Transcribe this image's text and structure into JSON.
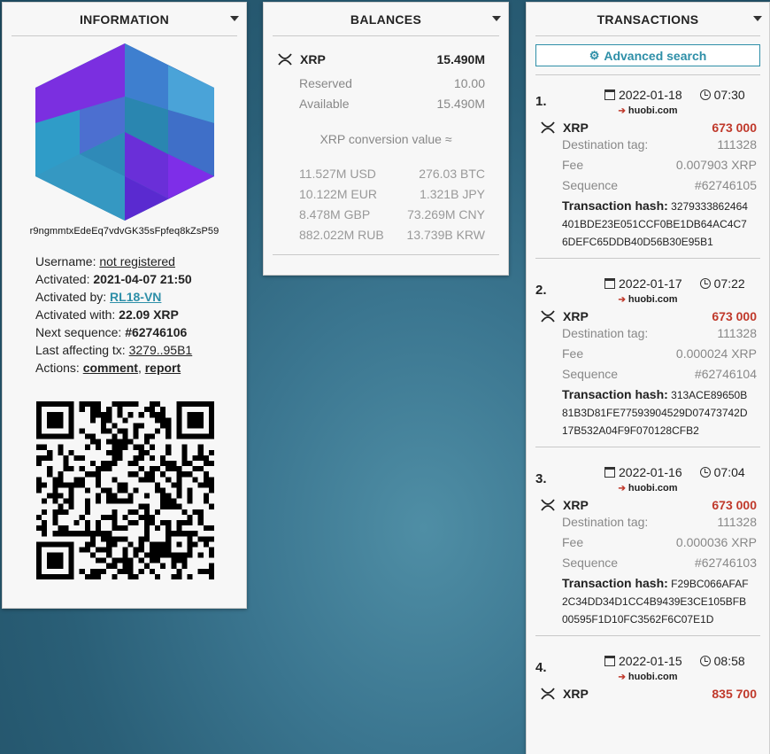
{
  "information": {
    "title": "INFORMATION",
    "address": "r9ngmmtxEdeEq7vdvGK35sFpfeq8kZsP59",
    "username_label": "Username:",
    "username_value": "not registered",
    "activated_label": "Activated:",
    "activated_value": "2021-04-07 21:50",
    "activated_by_label": "Activated by:",
    "activated_by_value": "RL18-VN",
    "activated_with_label": "Activated with:",
    "activated_with_value": "22.09 XRP",
    "next_sequence_label": "Next sequence:",
    "next_sequence_value": "#62746106",
    "last_tx_label": "Last affecting tx:",
    "last_tx_value": "3279..95B1",
    "actions_label": "Actions:",
    "action_comment": "comment",
    "action_sep": ",",
    "action_report": "report"
  },
  "balances": {
    "title": "BALANCES",
    "currency": "XRP",
    "total": "15.490M",
    "reserved_label": "Reserved",
    "reserved_value": "10.00",
    "available_label": "Available",
    "available_value": "15.490M",
    "conversion_title": "XRP conversion value ≈",
    "conversions": [
      [
        "11.527M USD",
        "276.03 BTC"
      ],
      [
        "10.122M EUR",
        "1.321B JPY"
      ],
      [
        "8.478M GBP",
        "73.269M CNY"
      ],
      [
        "882.022M RUB",
        "13.739B KRW"
      ]
    ]
  },
  "transactions": {
    "title": "TRANSACTIONS",
    "advanced_search": "Advanced search",
    "dest_tag_label": "Destination tag:",
    "fee_label": "Fee",
    "sequence_label": "Sequence",
    "hash_label": "Transaction hash:",
    "items": [
      {
        "num": "1.",
        "date": "2022-01-18",
        "time": "07:30",
        "dest": "huobi.com",
        "currency": "XRP",
        "amount": "673 000",
        "dest_tag": "111328",
        "fee": "0.007903 XRP",
        "sequence": "#62746105",
        "hash1": "3279333862464",
        "hash2": "401BDE23E051CCF0BE1DB64AC4C7",
        "hash3": "6DEFC65DDB40D56B30E95B1"
      },
      {
        "num": "2.",
        "date": "2022-01-17",
        "time": "07:22",
        "dest": "huobi.com",
        "currency": "XRP",
        "amount": "673 000",
        "dest_tag": "111328",
        "fee": "0.000024 XRP",
        "sequence": "#62746104",
        "hash1": "313ACE89650B",
        "hash2": "81B3D81FE77593904529D07473742D",
        "hash3": "17B532A04F9F070128CFB2"
      },
      {
        "num": "3.",
        "date": "2022-01-16",
        "time": "07:04",
        "dest": "huobi.com",
        "currency": "XRP",
        "amount": "673 000",
        "dest_tag": "111328",
        "fee": "0.000036 XRP",
        "sequence": "#62746103",
        "hash1": "F29BC066AFAF",
        "hash2": "2C34DD34D1CC4B9439E3CE105BFB",
        "hash3": "00595F1D10FC3562F6C07E1D"
      },
      {
        "num": "4.",
        "date": "2022-01-15",
        "time": "08:58",
        "dest": "huobi.com",
        "currency": "XRP",
        "amount": "835 700"
      }
    ]
  },
  "icons": {
    "collapse": "chevron-down-icon",
    "currency": "xrp-icon",
    "search": "gear-icon",
    "date": "calendar-icon",
    "time": "clock-icon",
    "dest": "arrow-right-icon"
  },
  "colors": {
    "accent": "#2e8fa8",
    "amount": "#c0392b",
    "panel_bg": "#f7f7f7"
  }
}
